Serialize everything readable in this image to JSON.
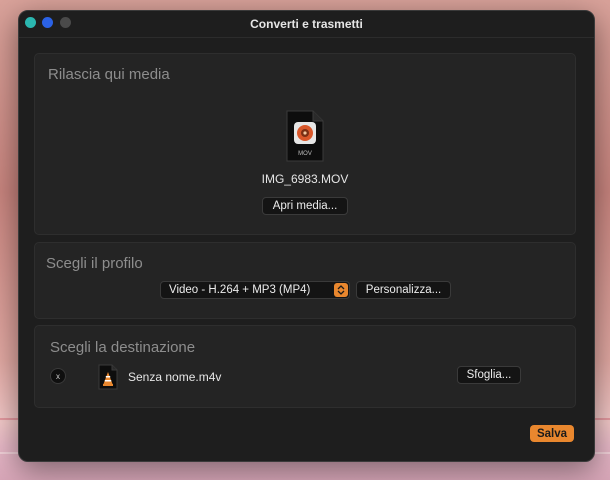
{
  "window": {
    "title": "Converti e trasmetti"
  },
  "media_panel": {
    "title": "Rilascia qui media",
    "file_badge": "MOV",
    "file_name": "IMG_6983.MOV",
    "open_button": "Apri media..."
  },
  "profile_panel": {
    "title": "Scegli il profilo",
    "selected_profile": "Video - H.264 + MP3 (MP4)",
    "customize_button": "Personalizza..."
  },
  "destination_panel": {
    "title": "Scegli la destinazione",
    "clear_label": "x",
    "file_name": "Senza nome.m4v",
    "browse_button": "Sfoglia..."
  },
  "footer": {
    "save_button": "Salva"
  },
  "colors": {
    "accent": "#e9872e",
    "close": "#2bb7b0",
    "minimize": "#2b62e6",
    "zoom": "#4a4a4a"
  },
  "icons": {
    "media_file": "video-file-icon",
    "destination_file": "vlc-file-icon",
    "stepper": "chevron-updown-icon"
  }
}
